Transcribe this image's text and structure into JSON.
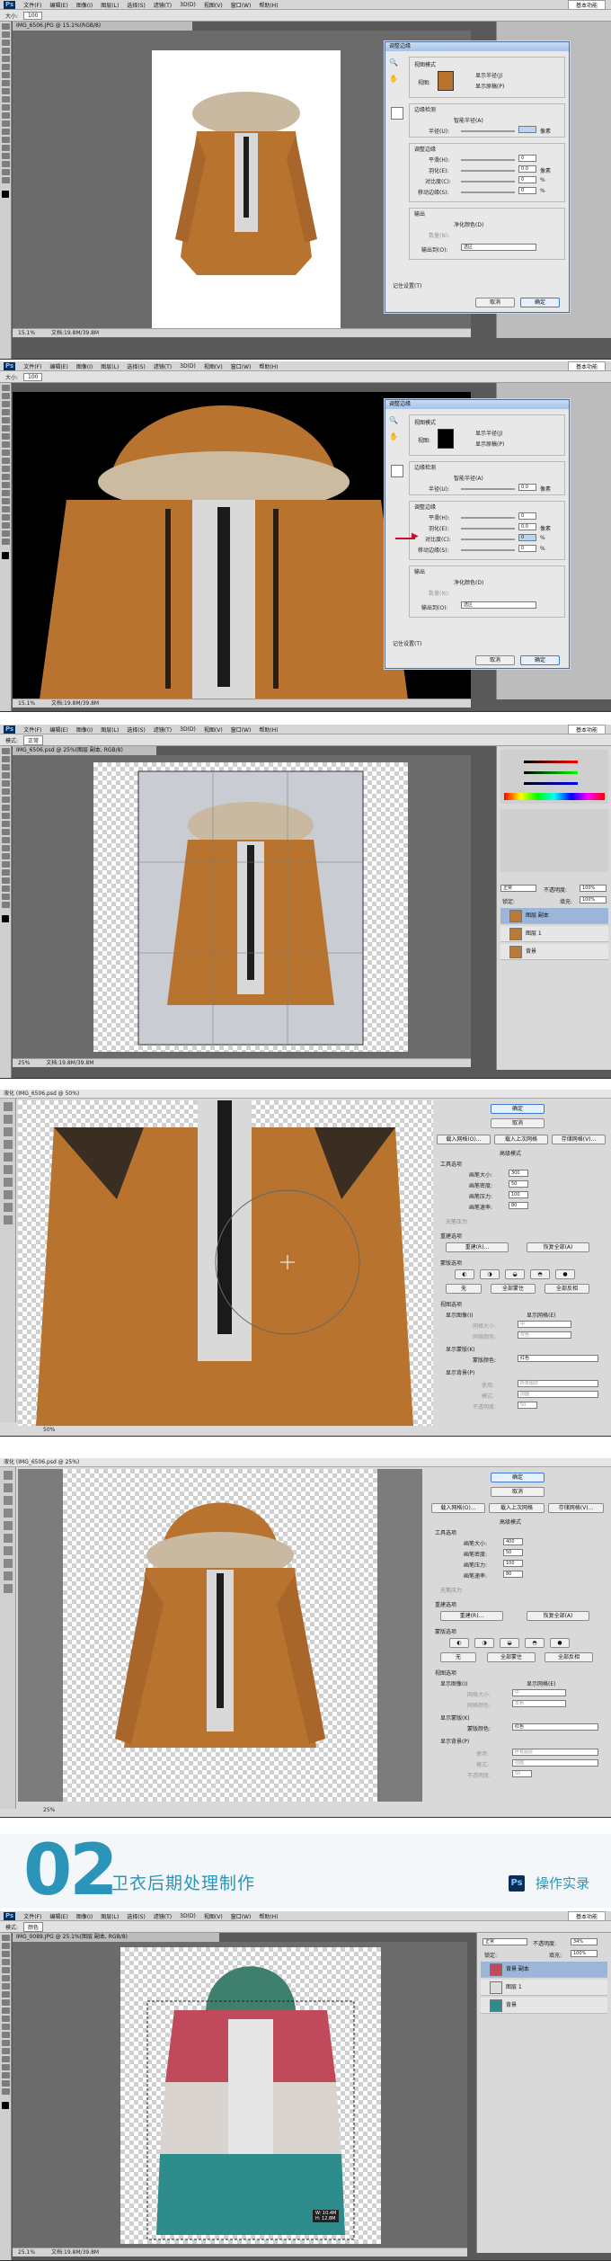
{
  "menu": {
    "ps": "Ps",
    "items": [
      "文件(F)",
      "编辑(E)",
      "图像(I)",
      "图层(L)",
      "选择(S)",
      "滤镜(T)",
      "3D(D)",
      "视图(V)",
      "窗口(W)",
      "帮助(H)"
    ],
    "workspace": "基本功能"
  },
  "options": {
    "size_label": "大小:",
    "size_value": "100",
    "mode_label": "模式:",
    "mode_value": "正常",
    "mode_value2": "颜色"
  },
  "shots": {
    "s1": {
      "tab": "IMG_6506.JPG @ 15.1%(RGB/8)",
      "zoom": "15.1%",
      "doc": "文档:19.8M/39.8M",
      "dialog": {
        "title": "调整边缘",
        "view_mode": "视图模式",
        "view": "视图:",
        "show_radius": "显示半径(J)",
        "show_original": "显示原稿(P)",
        "edge_detection": "边缘检测",
        "smart_radius": "智能半径(A)",
        "radius": "半径(U):",
        "radius_value": "",
        "radius_unit": "像素",
        "adjust_edge": "调整边缘",
        "smooth": "平滑(H):",
        "smooth_value": "0",
        "feather": "羽化(E):",
        "feather_value": "0.0",
        "feather_unit": "像素",
        "contrast": "对比度(C):",
        "contrast_value": "0",
        "contrast_unit": "%",
        "shift_edge": "移动边缘(S):",
        "shift_value": "0",
        "shift_unit": "%",
        "output": "输出",
        "decontaminate": "净化颜色(D)",
        "amount": "数量(N):",
        "output_to": "输出到(O):",
        "output_value": "选区",
        "remember": "记住设置(T)",
        "cancel": "取消",
        "ok": "确定"
      }
    },
    "s2": {
      "zoom": "15.1%",
      "doc": "文档:19.8M/39.8M",
      "radius_value": "0.0",
      "contrast_value": "0",
      "shift_value": "0"
    },
    "s3": {
      "tabs": [
        "IMG_6506.psd @ 25%(图层 副本, RGB/8)"
      ],
      "zoom": "25%",
      "doc": "文档:19.8M/39.8M",
      "layers": {
        "blend": "正常",
        "opacity_label": "不透明度:",
        "opacity_value": "100%",
        "lock_label": "锁定:",
        "fill_label": "填充:",
        "fill_value": "100%",
        "items": [
          "图层 副本",
          "图层 1",
          "背景"
        ]
      }
    },
    "s4": {
      "title": "液化 (IMG_6506.psd @ 50%)",
      "zoom": "50%",
      "ok": "确定",
      "cancel": "取消",
      "load_mesh": "载入网格(O)...",
      "load_last": "载入上次网格",
      "save_mesh": "存储网格(V)...",
      "advanced": "高级模式",
      "tool_options": "工具选项",
      "brush_size": "画笔大小:",
      "brush_size_value": "300",
      "brush_density": "画笔密度:",
      "brush_density_value": "50",
      "brush_pressure": "画笔压力:",
      "brush_pressure_value": "100",
      "brush_rate": "画笔速率:",
      "brush_rate_value": "80",
      "stylus": "光笔压力",
      "rebuild_options": "重建选项",
      "rebuild": "重建(R)...",
      "restore_all": "恢复全部(A)",
      "mask_options": "蒙版选项",
      "none": "无",
      "mask_all": "全部蒙住",
      "invert_all": "全部反相",
      "view_options": "视图选项",
      "show_image": "显示图像(I)",
      "show_mesh": "显示网格(E)",
      "mesh_size": "网格大小:",
      "mesh_size_value": "中",
      "mesh_color": "网格颜色:",
      "mesh_color_value": "灰色",
      "show_mask": "显示蒙版(K)",
      "mask_color": "蒙版颜色:",
      "mask_color_value": "红色",
      "show_backdrop": "显示背景(P)",
      "use": "使用:",
      "use_value": "所有图层",
      "mode": "模式:",
      "mode_value": "前面",
      "opacity": "不透明度:",
      "opacity_value": "50"
    },
    "s5": {
      "title": "液化 (IMG_6506.psd @ 25%)",
      "zoom": "25%",
      "brush_size_value": "400",
      "brush_density_value": "50",
      "brush_pressure_value": "100",
      "brush_rate_value": "80"
    },
    "s7": {
      "tab": "IMG_0089.JPG @ 25.1%(图层 副本, RGB/8)",
      "zoom": "25.1%",
      "doc": "文档:19.8M/39.8M",
      "transform_hint": "W: 10.4M\nH: 12.8M",
      "layers": {
        "blend": "正常",
        "opacity_value": "34%",
        "fill_value": "100%",
        "items": [
          "背景 副本",
          "图层 1",
          "背景"
        ]
      }
    }
  },
  "banner": {
    "number": "02",
    "subtitle": "卫衣后期处理制作",
    "ps_icon": "Ps",
    "record": "操作实录"
  },
  "colors": {
    "accent": "#2a94b9",
    "jacket": "#b8742f",
    "hoodie_red": "#c04a5c",
    "hoodie_teal": "#2f8c8c",
    "arrow": "#c8102e"
  }
}
